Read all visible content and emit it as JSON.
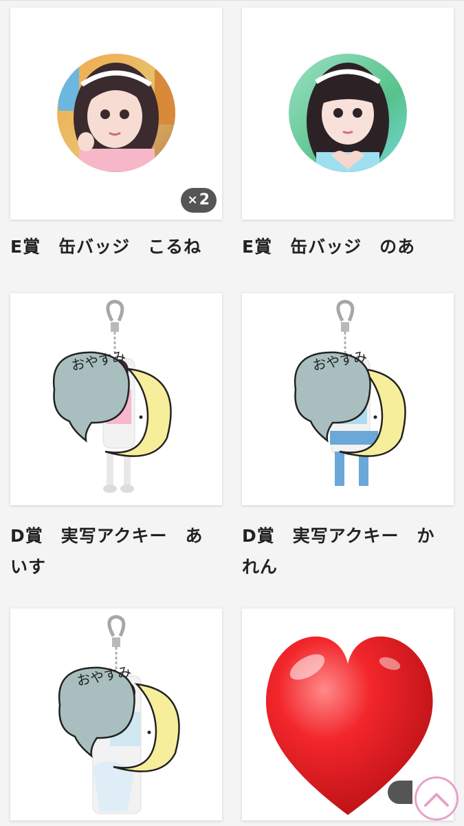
{
  "products": [
    {
      "caption": "E賞　缶バッジ　こるね",
      "badge_count": "2",
      "type": "badge-photo"
    },
    {
      "caption": "E賞　缶バッジ　のあ",
      "type": "badge-photo"
    },
    {
      "caption_line1": "D賞　実写アクキー　あ",
      "caption_line2": "いす",
      "type": "acrylic-keychain",
      "bubble_text": "おやすみ"
    },
    {
      "caption_line1": "D賞　実写アクキー　か",
      "caption_line2": "れん",
      "type": "acrylic-keychain",
      "bubble_text": "おやすみ"
    },
    {
      "type": "acrylic-keychain",
      "bubble_text": "おやすみ"
    },
    {
      "type": "heart-emoji-overlay"
    }
  ],
  "badge_prefix": "×",
  "colors": {
    "background": "#f4f4f4",
    "card": "#ffffff",
    "badge": "#555555",
    "scroll_top_border": "#e6a2c8",
    "bubble": "#a9bfbf",
    "moon": "#f7ee9c",
    "heart": "#e6161b"
  }
}
